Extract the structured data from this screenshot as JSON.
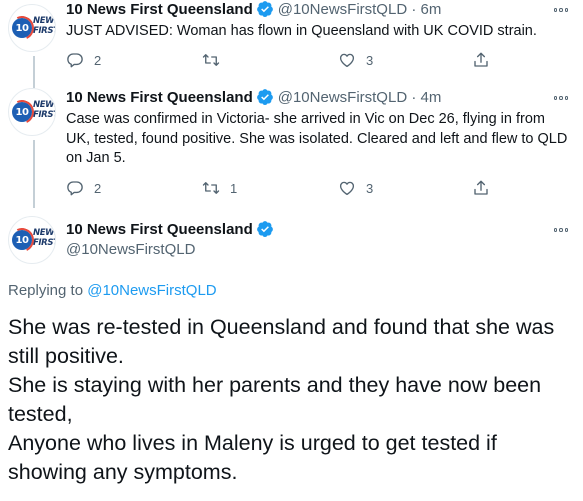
{
  "tweets": [
    {
      "author_name": "10 News First Queensland",
      "handle": "@10NewsFirstQLD",
      "separator": "·",
      "time": "6m",
      "text": "JUST ADVISED: Woman has flown in Queensland with UK COVID strain.",
      "reply_count": "2",
      "retweet_count": "",
      "like_count": "3"
    },
    {
      "author_name": "10 News First Queensland",
      "handle": "@10NewsFirstQLD",
      "separator": "·",
      "time": "4m",
      "text": "Case was confirmed in Victoria- she arrived in Vic on Dec 26, flying in from UK, tested, found positive. She was isolated. Cleared and left and flew to QLD on Jan 5.",
      "reply_count": "2",
      "retweet_count": "1",
      "like_count": "3"
    }
  ],
  "focus_tweet": {
    "author_name": "10 News First Queensland",
    "handle": "@10NewsFirstQLD",
    "replying_prefix": "Replying to",
    "replying_to": "@10NewsFirstQLD",
    "paragraphs": [
      "She was re-tested in Queensland and found that she was still positive.",
      "She is staying with her parents and they have now been tested,",
      "Anyone who lives in Maleny is urged to get tested if showing any symptoms."
    ]
  },
  "avatar": {
    "logo_number": "10",
    "logo_word_top": "NEWS",
    "logo_word_bottom": "FIRST"
  },
  "icons": [
    "reply-icon",
    "retweet-icon",
    "like-icon",
    "share-icon",
    "verified-badge-icon",
    "more-icon"
  ],
  "colors": {
    "verified": "#1d9bf0",
    "link": "#1d9bf0",
    "secondary_text": "#536471",
    "thread_line": "#c4cfd6"
  }
}
